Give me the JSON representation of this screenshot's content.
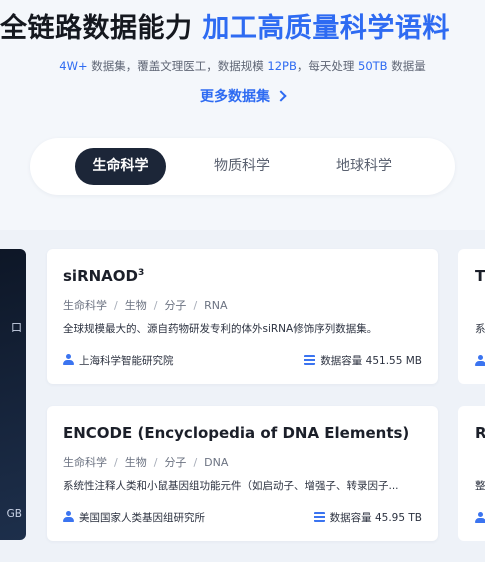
{
  "hero": {
    "title_dark": "全链路数据能力",
    "title_blue": "加工高质量科学语料",
    "stats_a": "4W+",
    "stats_b": " 数据集，覆盖文理医工，数据规模 ",
    "stats_c": "12PB",
    "stats_d": "，每天处理 ",
    "stats_e": "50TB",
    "stats_f": " 数据量",
    "more_label": "更多数据集"
  },
  "tabs": [
    {
      "label": "生命科学",
      "active": true
    },
    {
      "label": "物质科学",
      "active": false
    },
    {
      "label": "地球科学",
      "active": false
    }
  ],
  "left_card": {
    "glyph": "口",
    "size_text": "GB"
  },
  "cards": [
    {
      "name": "siRNAOD",
      "name_sup": "3",
      "tags": [
        "生命科学",
        "生物",
        "分子",
        "RNA"
      ],
      "desc": "全球规模最大的、源自药物研发专利的体外siRNA修饰序列数据集。",
      "org": "上海科学智能研究院",
      "volume": "数据容量 451.55 MB"
    },
    {
      "name": "ENCODE (Encyclopedia of DNA Elements)",
      "name_sup": "",
      "tags": [
        "生命科学",
        "生物",
        "分子",
        "DNA"
      ],
      "desc": "系统性注释人类和小鼠基因组功能元件（如启动子、增强子、转录因子...",
      "org": "美国国家人类基因组研究所",
      "volume": "数据容量 45.95 TB"
    }
  ],
  "right_cards": [
    {
      "title": "T",
      "desc": "系"
    },
    {
      "title": "R",
      "desc": "整"
    }
  ],
  "colors": {
    "accent": "#2e6bf2",
    "tab_active_bg": "#1c2638",
    "page_bg": "#eef2f8"
  }
}
